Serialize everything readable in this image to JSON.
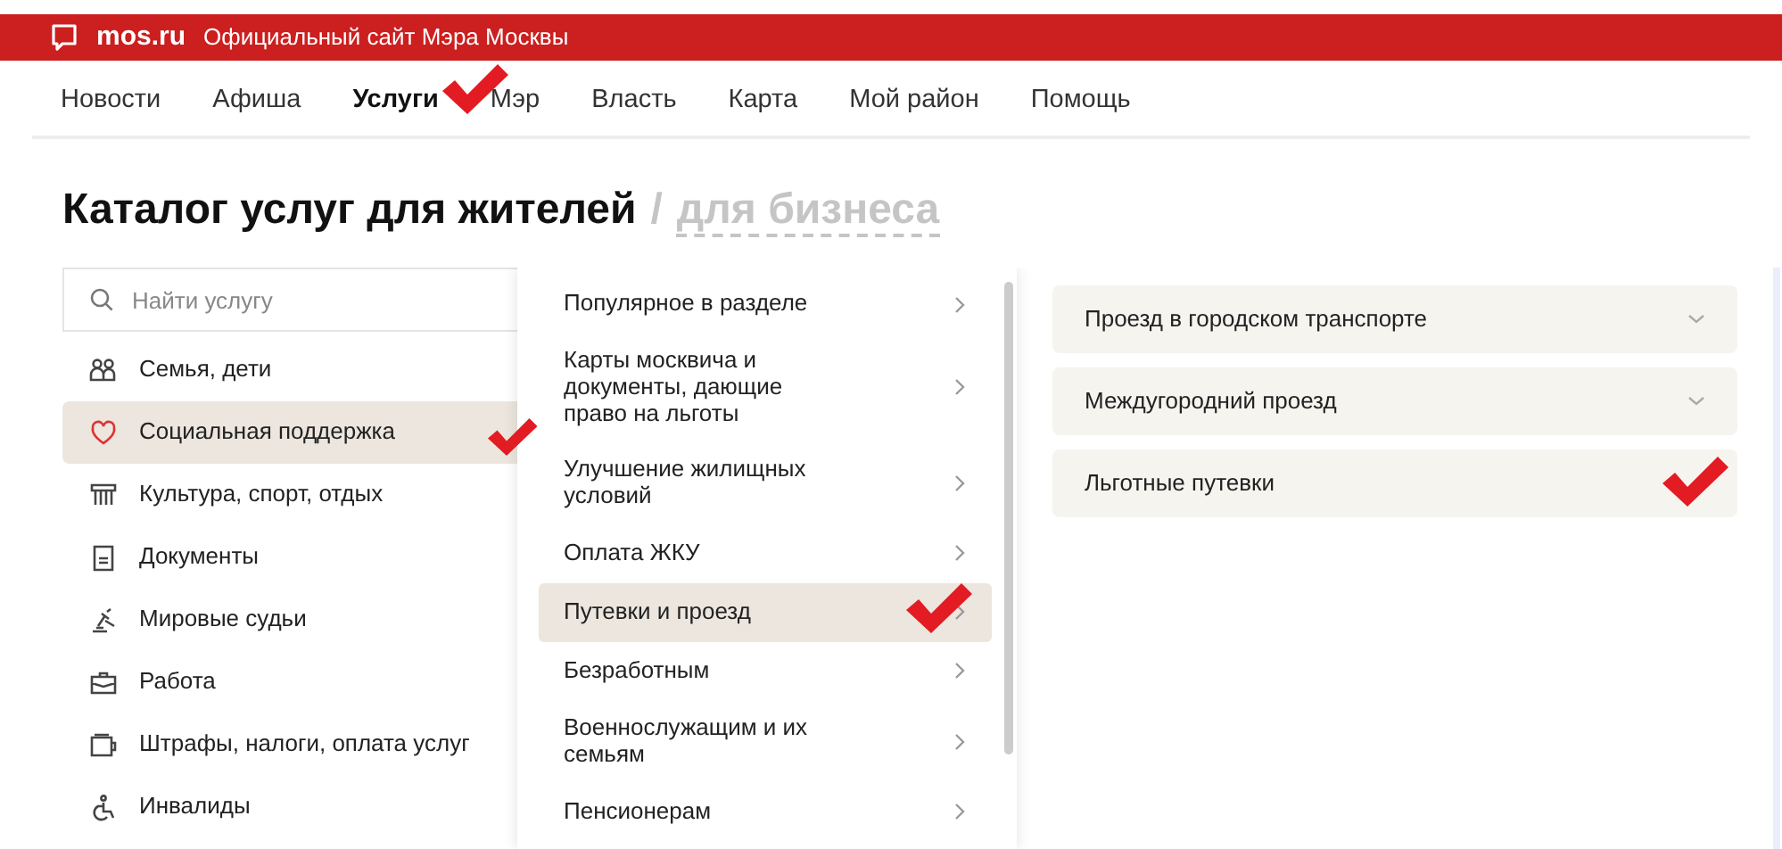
{
  "header": {
    "logo": "mos.ru",
    "tagline": "Официальный сайт Мэра Москвы"
  },
  "nav": [
    {
      "label": "Новости",
      "selected": false,
      "marked": false
    },
    {
      "label": "Афиша",
      "selected": false,
      "marked": false
    },
    {
      "label": "Услуги",
      "selected": true,
      "marked": true
    },
    {
      "label": "Мэр",
      "selected": false,
      "marked": false
    },
    {
      "label": "Власть",
      "selected": false,
      "marked": false
    },
    {
      "label": "Карта",
      "selected": false,
      "marked": false
    },
    {
      "label": "Мой район",
      "selected": false,
      "marked": false
    },
    {
      "label": "Помощь",
      "selected": false,
      "marked": false
    }
  ],
  "title": {
    "main": "Каталог услуг для жителей",
    "separator": "/",
    "alternate": "для бизнеса"
  },
  "search": {
    "placeholder": "Найти услугу"
  },
  "categories": [
    {
      "label": "Семья, дети",
      "selected": false,
      "marked": false
    },
    {
      "label": "Социальная поддержка",
      "selected": true,
      "marked": true
    },
    {
      "label": "Культура, спорт, отдых",
      "selected": false,
      "marked": false
    },
    {
      "label": "Документы",
      "selected": false,
      "marked": false
    },
    {
      "label": "Мировые судьи",
      "selected": false,
      "marked": false
    },
    {
      "label": "Работа",
      "selected": false,
      "marked": false
    },
    {
      "label": "Штрафы, налоги, оплата услуг",
      "selected": false,
      "marked": false
    },
    {
      "label": "Инвалиды",
      "selected": false,
      "marked": false
    }
  ],
  "subcategories": [
    {
      "label": "Популярное в разделе",
      "selected": false,
      "marked": false
    },
    {
      "label": "Карты москвича и документы, дающие право на льготы",
      "selected": false,
      "marked": false
    },
    {
      "label": "Улучшение жилищных условий",
      "selected": false,
      "marked": false
    },
    {
      "label": "Оплата ЖКУ",
      "selected": false,
      "marked": false
    },
    {
      "label": "Путевки и проезд",
      "selected": true,
      "marked": true
    },
    {
      "label": "Безработным",
      "selected": false,
      "marked": false
    },
    {
      "label": "Военнослужащим и их семьям",
      "selected": false,
      "marked": false
    },
    {
      "label": "Пенсионерам",
      "selected": false,
      "marked": false
    }
  ],
  "services": [
    {
      "label": "Проезд в городском транспорте",
      "expandable": true,
      "marked": false
    },
    {
      "label": "Междугородний проезд",
      "expandable": true,
      "marked": false
    },
    {
      "label": "Льготные путевки",
      "expandable": false,
      "marked": true
    }
  ]
}
